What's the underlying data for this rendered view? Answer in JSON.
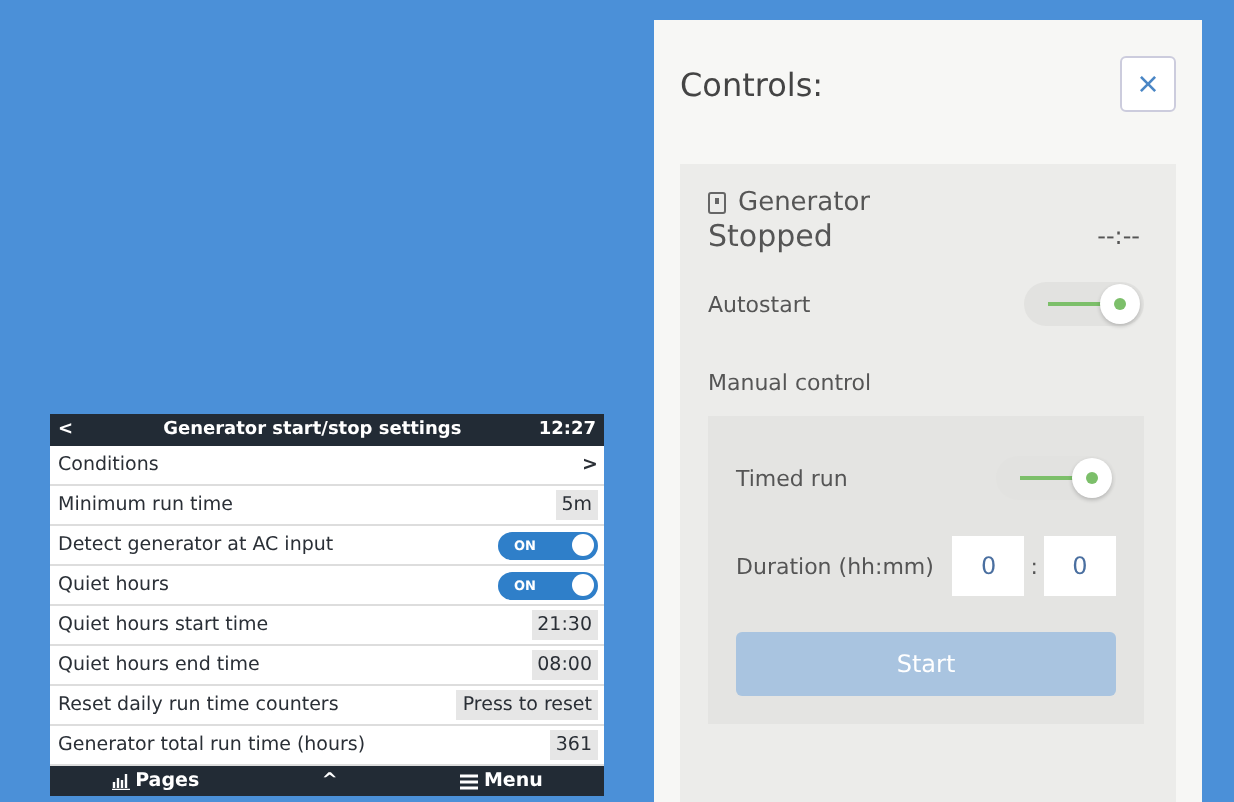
{
  "device_screen": {
    "header": {
      "back": "<",
      "title": "Generator start/stop settings",
      "time": "12:27"
    },
    "rows": [
      {
        "kind": "link",
        "label": "Conditions",
        "arrow": ">"
      },
      {
        "kind": "value",
        "label": "Minimum run time",
        "value": "5m"
      },
      {
        "kind": "toggle",
        "label": "Detect generator at AC input",
        "on": true,
        "state_text": "ON"
      },
      {
        "kind": "toggle",
        "label": "Quiet hours",
        "on": true,
        "state_text": "ON"
      },
      {
        "kind": "value",
        "label": "Quiet hours start time",
        "value": "21:30"
      },
      {
        "kind": "value",
        "label": "Quiet hours end time",
        "value": "08:00"
      },
      {
        "kind": "button",
        "label": "Reset daily run time counters",
        "value": "Press to reset"
      },
      {
        "kind": "value",
        "label": "Generator total run time (hours)",
        "value": "361"
      }
    ],
    "footer": {
      "pages": "Pages",
      "up": "^",
      "menu": "Menu"
    }
  },
  "controls_panel": {
    "title": "Controls:",
    "close": "×",
    "generator": {
      "name": "Generator",
      "status": "Stopped",
      "timer": "--:--",
      "autostart": {
        "label": "Autostart",
        "on": true
      },
      "manual_control": {
        "label": "Manual control",
        "timed_run": {
          "label": "Timed run",
          "on": true
        },
        "duration": {
          "label": "Duration (hh:mm)",
          "hours": "0",
          "separator": ":",
          "minutes": "0"
        },
        "start_button": {
          "label": "Start",
          "disabled": true
        }
      }
    }
  }
}
